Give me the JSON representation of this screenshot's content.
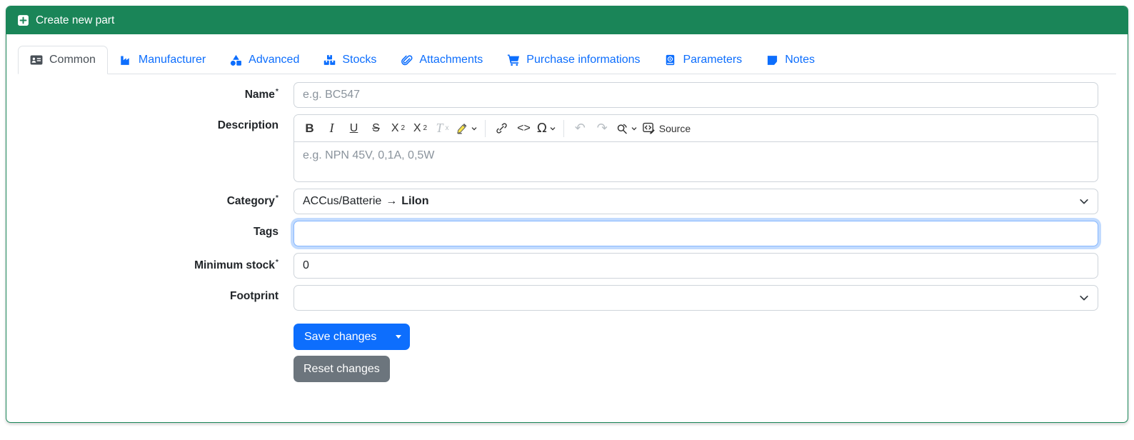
{
  "header": {
    "title": "Create new part",
    "icon": "plus-square-icon"
  },
  "tabs": [
    {
      "label": "Common",
      "icon": "id-card-icon",
      "active": true
    },
    {
      "label": "Manufacturer",
      "icon": "factory-icon",
      "active": false
    },
    {
      "label": "Advanced",
      "icon": "shapes-icon",
      "active": false
    },
    {
      "label": "Stocks",
      "icon": "boxes-icon",
      "active": false
    },
    {
      "label": "Attachments",
      "icon": "paperclip-icon",
      "active": false
    },
    {
      "label": "Purchase informations",
      "icon": "cart-icon",
      "active": false
    },
    {
      "label": "Parameters",
      "icon": "book-icon",
      "active": false
    },
    {
      "label": "Notes",
      "icon": "sticky-note-icon",
      "active": false
    }
  ],
  "form": {
    "name": {
      "label": "Name",
      "required": "*",
      "placeholder": "e.g. BC547",
      "value": ""
    },
    "description": {
      "label": "Description",
      "placeholder": "e.g. NPN 45V, 0,1A, 0,5W",
      "value": ""
    },
    "category": {
      "label": "Category",
      "required": "*",
      "path": "ACCus/Batterie",
      "arrow": "→",
      "selected": "LiIon"
    },
    "tags": {
      "label": "Tags",
      "value": "",
      "focused": true
    },
    "minimum_stock": {
      "label": "Minimum stock",
      "required": "*",
      "value": "0"
    },
    "footprint": {
      "label": "Footprint",
      "value": ""
    }
  },
  "editor_toolbar": {
    "bold": "B",
    "italic": "I",
    "underline": "U",
    "strikethrough": "S",
    "subscript_base": "X",
    "subscript_mark": "2",
    "superscript_base": "X",
    "superscript_mark": "2",
    "remove_format_base": "T",
    "remove_format_mark": "x",
    "highlight_icon": "marker-pen-icon",
    "link_icon": "link-icon",
    "code": "<>",
    "special_characters": "Ω",
    "undo": "↶",
    "redo": "↷",
    "find_replace_icon": "find-replace-icon",
    "source_icon": "source-code-icon",
    "source_label": "Source"
  },
  "buttons": {
    "save": "Save changes",
    "reset": "Reset changes"
  },
  "colors": {
    "header_green": "#1a8558",
    "primary_blue": "#0d6efd",
    "secondary_gray": "#6c757d"
  }
}
